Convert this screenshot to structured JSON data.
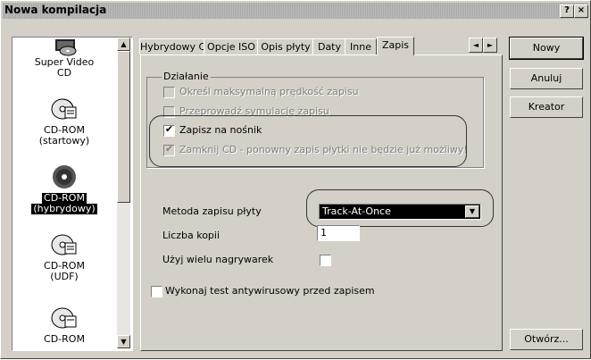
{
  "window": {
    "title": "Nowa kompilacja",
    "help_button": "?",
    "close_button": "×"
  },
  "left_panel": {
    "items": [
      {
        "label_line1": "Super Video",
        "label_line2": "CD",
        "icon": "video-cd-icon",
        "selected": false
      },
      {
        "label_line1": "CD-ROM",
        "label_line2": "(startowy)",
        "icon": "bootable-cd-icon",
        "selected": false
      },
      {
        "label_line1": "CD-ROM",
        "label_line2": "(hybrydowy)",
        "icon": "hybrid-cd-icon",
        "selected": true
      },
      {
        "label_line1": "CD-ROM",
        "label_line2": "(UDF)",
        "icon": "udf-cd-icon",
        "selected": false
      },
      {
        "label_line1": "CD-ROM",
        "label_line2": "",
        "icon": "cd-icon",
        "selected": false
      }
    ]
  },
  "tabs": [
    {
      "label": "Hybrydowy CD"
    },
    {
      "label": "Opcje ISO"
    },
    {
      "label": "Opis płyty"
    },
    {
      "label": "Daty"
    },
    {
      "label": "Inne"
    },
    {
      "label": "Zapis",
      "active": true
    }
  ],
  "tab_scroll": {
    "left": "◄",
    "right": "►"
  },
  "action_group": {
    "title": "Działanie",
    "options": [
      {
        "label": "Określ maksymalną prędkość zapisu",
        "checked": false,
        "enabled": false
      },
      {
        "label": "Przeprowadź symulację zapisu",
        "checked": false,
        "enabled": false
      },
      {
        "label": "Zapisz na nośnik",
        "checked": true,
        "enabled": true
      },
      {
        "label": "Zamknij CD - ponowny zapis płytki nie będzie już możliwy!",
        "checked": true,
        "enabled": false
      }
    ]
  },
  "write_method": {
    "label": "Metoda zapisu płyty",
    "value": "Track-At-Once"
  },
  "copies": {
    "label": "Liczba kopii",
    "value": "1"
  },
  "multi_recorders": {
    "label": "Użyj wielu nagrywarek",
    "checked": false
  },
  "antivirus": {
    "label": "Wykonaj test antywirusowy przed zapisem",
    "checked": false
  },
  "buttons": {
    "new": "Nowy",
    "cancel": "Anuluj",
    "wizard": "Kreator",
    "open": "Otwórz..."
  },
  "colors": {
    "face": "#d4d0c8",
    "selection": "#000000",
    "disabled_text": "#808080"
  }
}
